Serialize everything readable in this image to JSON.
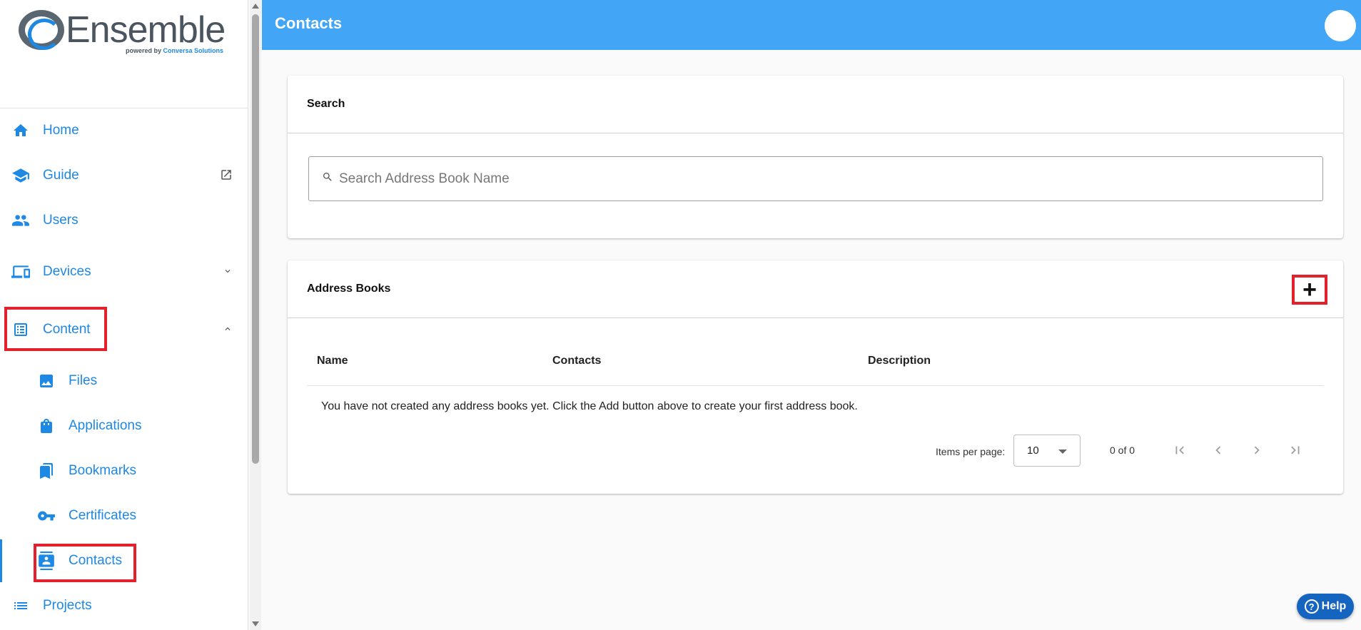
{
  "brand": {
    "name": "Ensemble",
    "powered_prefix": "powered by",
    "powered_company": "Conversa Solutions"
  },
  "sidebar": {
    "items": [
      {
        "label": "Home",
        "icon": "home-icon"
      },
      {
        "label": "Guide",
        "icon": "school-icon",
        "external": true
      },
      {
        "label": "Users",
        "icon": "users-icon"
      },
      {
        "label": "Devices",
        "icon": "devices-icon",
        "expanded": false
      },
      {
        "label": "Content",
        "icon": "content-list-icon",
        "expanded": true
      },
      {
        "label": "Files",
        "icon": "image-icon"
      },
      {
        "label": "Applications",
        "icon": "shopping-bag-icon"
      },
      {
        "label": "Bookmarks",
        "icon": "bookmarks-icon"
      },
      {
        "label": "Certificates",
        "icon": "key-icon"
      },
      {
        "label": "Contacts",
        "icon": "contacts-icon",
        "active": true
      },
      {
        "label": "Projects",
        "icon": "list-icon"
      }
    ]
  },
  "header": {
    "title": "Contacts"
  },
  "search_card": {
    "title": "Search",
    "placeholder": "Search Address Book Name"
  },
  "address_books": {
    "title": "Address Books",
    "add_label": "+",
    "columns": [
      "Name",
      "Contacts",
      "Description"
    ],
    "empty_message": "You have not created any address books yet. Click the Add button above to create your first address book.",
    "rows": []
  },
  "paginator": {
    "items_per_page_label": "Items per page:",
    "items_per_page": "10",
    "range": "0 of 0"
  },
  "help": {
    "label": "Help"
  },
  "colors": {
    "primary": "#42a5f5",
    "link": "#1e88e5",
    "highlight": "#e3202b",
    "help": "#1565c0"
  }
}
